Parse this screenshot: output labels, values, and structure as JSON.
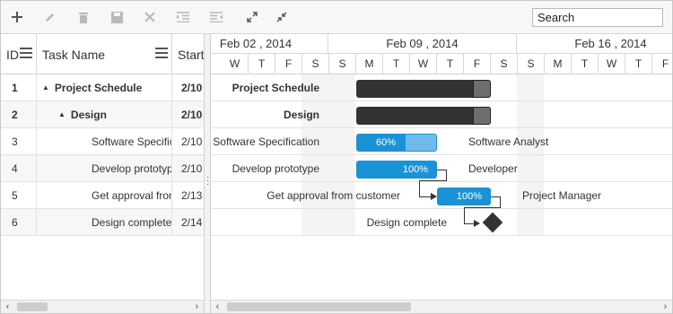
{
  "toolbar": {
    "search_placeholder": "Search",
    "icons": [
      "plus-icon",
      "pencil-icon",
      "trash-icon",
      "save-icon",
      "close-icon",
      "outdent-icon",
      "indent-icon",
      "expand-icon",
      "collapse-icon"
    ]
  },
  "grid": {
    "columns": [
      "ID",
      "Task Name",
      "Start"
    ],
    "rows": [
      {
        "id": "1",
        "name": "Project Schedule",
        "start": "2/10",
        "level": 0,
        "bold": true,
        "expander": "▲"
      },
      {
        "id": "2",
        "name": "Design",
        "start": "2/10",
        "level": 1,
        "bold": true,
        "expander": "▲"
      },
      {
        "id": "3",
        "name": "Software Specification",
        "start": "2/10",
        "level": 2,
        "bold": false
      },
      {
        "id": "4",
        "name": "Develop prototype",
        "start": "2/10",
        "level": 2,
        "bold": false
      },
      {
        "id": "5",
        "name": "Get approval from customer",
        "start": "2/13",
        "level": 2,
        "bold": false
      },
      {
        "id": "6",
        "name": "Design complete",
        "start": "2/14",
        "level": 2,
        "bold": false
      }
    ]
  },
  "timeline": {
    "weeks": [
      "Feb 02 , 2014",
      "Feb 09 , 2014",
      "Feb 16 , 2014"
    ],
    "days": [
      "W",
      "T",
      "F",
      "S",
      "S",
      "M",
      "T",
      "W",
      "T",
      "F",
      "S",
      "S",
      "M",
      "T",
      "W",
      "T",
      "F"
    ]
  },
  "tasks": {
    "project_schedule": {
      "label": "Project Schedule"
    },
    "design": {
      "label": "Design"
    },
    "software_spec": {
      "label": "Software Specification",
      "progress": "60%",
      "resource": "Software Analyst",
      "progress_value": 0.6
    },
    "develop_prototype": {
      "label": "Develop prototype",
      "progress": "100%",
      "resource": "Developer",
      "progress_value": 1.0
    },
    "get_approval": {
      "label": "Get approval from customer",
      "progress": "100%",
      "resource": "Project Manager",
      "progress_value": 1.0
    },
    "design_complete": {
      "label": "Design complete"
    }
  },
  "colors": {
    "parent_bar": "#333333",
    "child_bar": "#6fbcea",
    "child_progress": "#1a93d6",
    "milestone": "#333333"
  }
}
